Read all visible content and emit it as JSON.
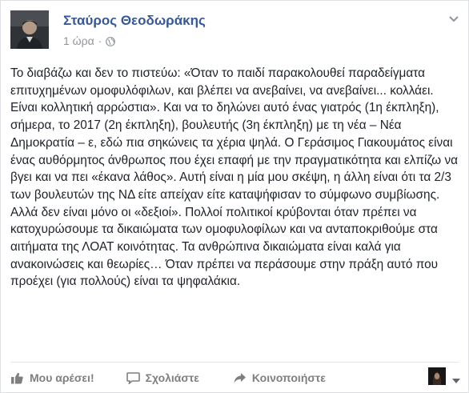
{
  "post": {
    "author_name": "Σταύρος Θεοδωράκης",
    "timestamp": "1 ώρα",
    "separator": "·",
    "privacy_icon": "globe-icon",
    "options_icon": "chevron-down-icon",
    "text": "Το διαβάζω και δεν το πιστεύω: «Όταν το παιδί παρακολουθεί παραδείγματα επιτυχημένων ομοφυλόφιλων, και βλέπει να ανεβαίνει, να ανεβαίνει... κολλάει. Είναι κολλητική αρρώστια». Και να το δηλώνει αυτό ένας γιατρός (1η έκπληξη), σήμερα, το 2017 (2η έκπληξη), βουλευτής (3η έκπληξη) με τη νέα – Νέα Δημοκρατία – ε, εδώ πια σηκώνεις τα χέρια ψηλά. Ο Γεράσιμος Γιακουμάτος είναι ένας αυθόρμητος άνθρωπος που έχει επαφή με την πραγματικότητα και ελπίζω να βγει και να πει «έκανα λάθος». Αυτή είναι η μία μου σκέψη, η άλλη είναι ότι τα 2/3 των βουλευτών της ΝΔ είτε απείχαν είτε καταψήφισαν το σύμφωνο συμβίωσης. Αλλά δεν είναι μόνο οι «δεξιοί». Πολλοί πολιτικοί κρύβονται όταν πρέπει να κατοχυρώσουμε τα δικαιώματα των ομοφυλοφίλων και να ανταποκριθούμε στα αιτήματα της ΛΟΑΤ κοινότητας. Τα ανθρώπινα δικαιώματα είναι καλά για ανακοινώσεις και θεωρίες… Όταν πρέπει να περάσουμε στην πράξη αυτό που προέχει (για πολλούς) είναι τα ψηφαλάκια."
  },
  "actions": {
    "like_label": "Μου αρέσει!",
    "comment_label": "Σχολιάστε",
    "share_label": "Κοινοποιήστε"
  },
  "colors": {
    "author_link": "#365899",
    "meta_text": "#90949c",
    "body_text": "#1d2129",
    "action_text": "#7f7f7f"
  }
}
